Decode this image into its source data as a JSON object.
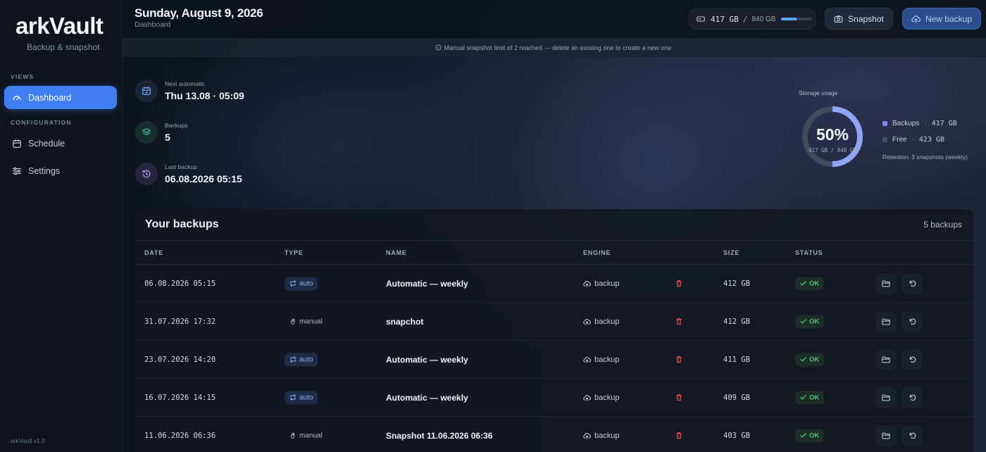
{
  "app": {
    "logo": "arkVault",
    "tagline": "Backup & snapshot",
    "version": "arkVault v1.0"
  },
  "sidebar": {
    "views_label": "VIEWS",
    "config_label": "CONFIGURATION",
    "items": [
      {
        "label": "Dashboard",
        "icon": "gauge-icon",
        "active": true
      },
      {
        "label": "Schedule",
        "icon": "calendar-icon",
        "active": false
      },
      {
        "label": "Settings",
        "icon": "sliders-icon",
        "active": false
      }
    ]
  },
  "header": {
    "date": "Sunday, August 9, 2026",
    "breadcrumb": "Dashboard",
    "storage": {
      "used": "417 GB",
      "total": "840 GB",
      "fraction": 0.5
    },
    "snapshot_label": "Snapshot",
    "new_backup_label": "New backup"
  },
  "notice": "Manual snapshot limit of 2 reached — delete an existing one to create a new one.",
  "stats": [
    {
      "label": "Next automatic",
      "value": "Thu 13.08 · 05:09",
      "icon": "calendar-icon"
    },
    {
      "label": "Backups",
      "value": "5",
      "icon": "layers-icon"
    },
    {
      "label": "Last backup",
      "value": "06.08.2026 05:15",
      "icon": "history-icon"
    }
  ],
  "storage_usage": {
    "label": "Storage usage",
    "percent": "50%",
    "fraction": 0.5,
    "detail": "417 GB / 840 GB",
    "legend": [
      {
        "name": "Backups",
        "value": "417 GB",
        "color": "#7b8cf5"
      },
      {
        "name": "Free",
        "value": "423 GB",
        "color": "#4a5262"
      }
    ],
    "retention": "Retention: 3 snapshots (weekly)"
  },
  "backups": {
    "title": "Your backups",
    "count": "5 backups",
    "columns": [
      "DATE",
      "TYPE",
      "NAME",
      "ENGINE",
      "SIZE",
      "STATUS"
    ],
    "rows": [
      {
        "date": "06.08.2026 05:15",
        "type": "auto",
        "name": "Automatic — weekly",
        "engine": "backup",
        "size": "412 GB",
        "status": "OK"
      },
      {
        "date": "31.07.2026 17:32",
        "type": "manual",
        "name": "snapchot",
        "engine": "backup",
        "size": "412 GB",
        "status": "OK"
      },
      {
        "date": "23.07.2026 14:20",
        "type": "auto",
        "name": "Automatic — weekly",
        "engine": "backup",
        "size": "411 GB",
        "status": "OK"
      },
      {
        "date": "16.07.2026 14:15",
        "type": "auto",
        "name": "Automatic — weekly",
        "engine": "backup",
        "size": "409 GB",
        "status": "OK"
      },
      {
        "date": "11.06.2026 06:36",
        "type": "manual",
        "name": "Snapshot 11.06.2026 06:36",
        "engine": "backup",
        "size": "403 GB",
        "status": "OK"
      }
    ]
  },
  "colors": {
    "accent": "#3f7ff2",
    "ok": "#4fc37a",
    "danger": "#e24b4b",
    "donut": "#8fa6f7"
  }
}
